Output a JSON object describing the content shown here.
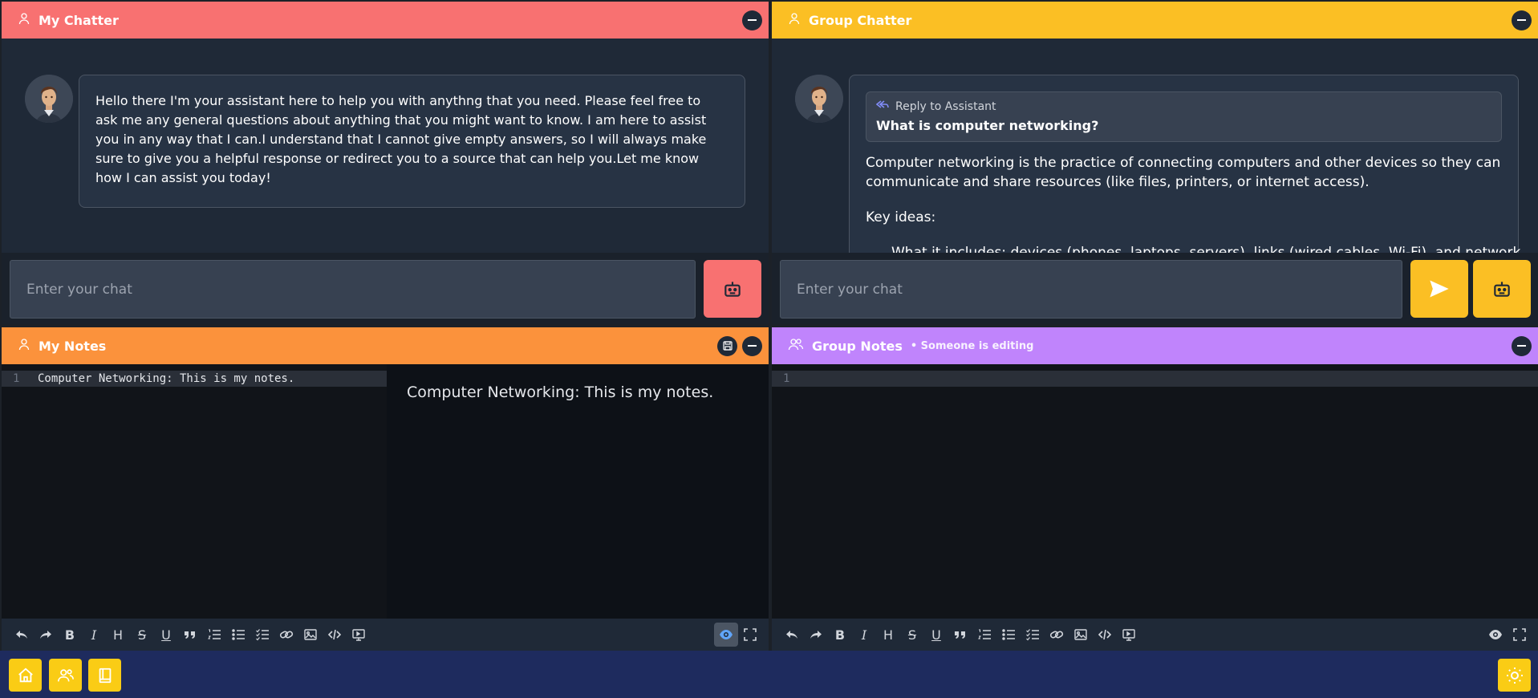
{
  "colors": {
    "my_chatter": "#f87171",
    "group_chatter": "#fbbf24",
    "my_notes": "#fb923c",
    "group_notes": "#c084fc",
    "footer_btn": "#facc15"
  },
  "my_chatter": {
    "title": "My Chatter",
    "message": "Hello there I'm your assistant here to help you with anythng that you need. Please feel free to ask me any general questions about anything that you might want to know. I am here to assist you in any way that I can.I understand that I cannot give empty answers, so I will always make sure to give you a helpful response or redirect you to a source that can help you.Let me know how I can assist you today!",
    "input_placeholder": "Enter your chat"
  },
  "group_chatter": {
    "title": "Group Chatter",
    "reply_label": "Reply to Assistant",
    "reply_question": "What is computer networking?",
    "answer_p1": "Computer networking is the practice of connecting computers and other devices so they can communicate and share resources (like files, printers, or internet access).",
    "answer_p2": "Key ideas:",
    "answer_p3": "What it includes: devices (phones, laptops, servers), links (wired cables, Wi-Fi), and network",
    "input_placeholder": "Enter your chat"
  },
  "my_notes": {
    "title": "My Notes",
    "line_number": "1",
    "code_text": "Computer Networking: This is my notes.",
    "preview_text": "Computer Networking: This is my notes."
  },
  "group_notes": {
    "title": "Group Notes",
    "status": "• Someone is editing",
    "line_number": "1"
  },
  "toolbar_icons": [
    "undo-icon",
    "redo-icon",
    "bold-icon",
    "italic-icon",
    "heading-icon",
    "strikethrough-icon",
    "underline-icon",
    "quote-icon",
    "ordered-list-icon",
    "unordered-list-icon",
    "task-list-icon",
    "link-icon",
    "image-icon",
    "code-icon",
    "preview-mode-icon"
  ],
  "toolbar_letters": {
    "bold": "B",
    "italic": "I",
    "heading": "H",
    "strike": "S",
    "underline": "U"
  }
}
